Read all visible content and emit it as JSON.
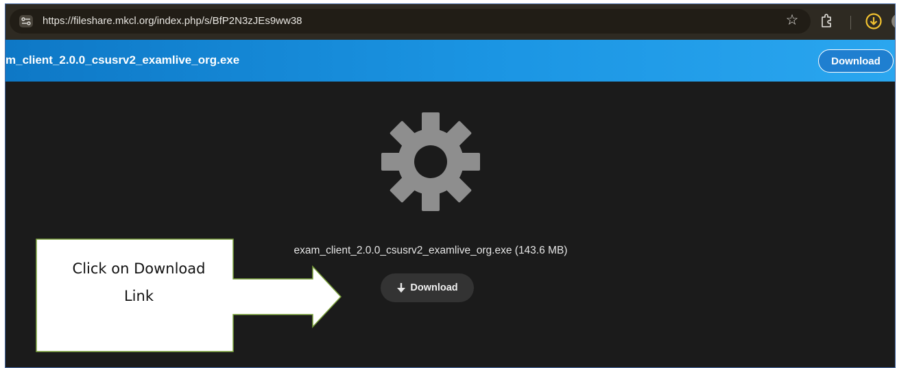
{
  "browser": {
    "url": "https://fileshare.mkcl.org/index.php/s/BfP2N3zJEs9ww38",
    "icons": [
      "site-info-icon",
      "star-icon",
      "extensions-icon",
      "download-status-icon"
    ]
  },
  "header": {
    "file_name": "​m_client_2.0.0_csusrv2_examlive_org.exe",
    "download_label": "Download"
  },
  "content": {
    "file_label": "exam_client_2.0.0_csusrv2_examlive_org.exe (143.6 MB)",
    "download_label": "Download",
    "icon": "gear-icon"
  },
  "callout": {
    "line1": "Click on Download",
    "line2": "Link"
  },
  "colors": {
    "header_blue": "#1b95e3",
    "page_dark": "#1b1b1b",
    "gear_gray": "#8e8e8e",
    "callout_border": "#7aa13a",
    "download_status_yellow": "#f2c230"
  }
}
